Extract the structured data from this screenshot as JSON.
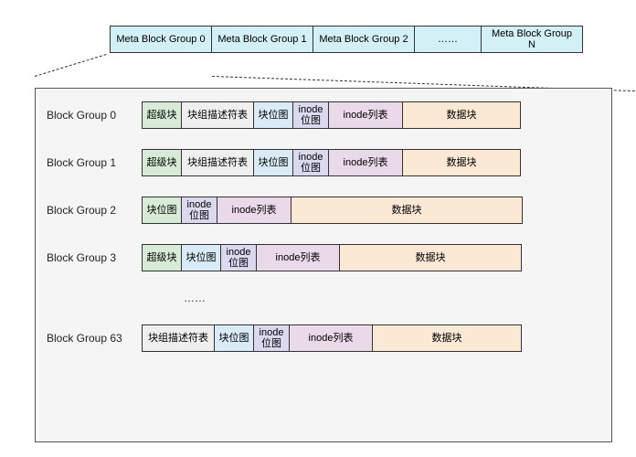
{
  "meta": {
    "cells": [
      "Meta Block Group 0",
      "Meta Block Group 1",
      "Meta Block Group 2",
      "……",
      "Meta Block Group N"
    ]
  },
  "labels": {
    "superblock": "超级块",
    "group_desc_table": "块组描述符表",
    "block_bitmap": "块位图",
    "inode_bitmap": "inode\n位图",
    "inode_list": "inode列表",
    "data_block": "数据块"
  },
  "groups": {
    "g0": "Block Group 0",
    "g1": "Block Group 1",
    "g2": "Block Group 2",
    "g3": "Block Group 3",
    "g63": "Block Group 63",
    "ellipsis": "……"
  }
}
